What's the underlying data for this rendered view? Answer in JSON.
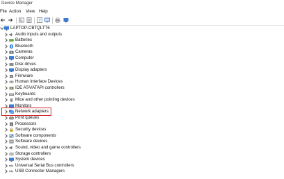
{
  "window": {
    "title": "Device Manager"
  },
  "menubar": {
    "items": [
      {
        "label": "File"
      },
      {
        "label": "Action"
      },
      {
        "label": "View"
      },
      {
        "label": "Help"
      }
    ]
  },
  "toolbar": {
    "buttons": [
      {
        "icon": "back-arrow-icon"
      },
      {
        "icon": "forward-arrow-icon"
      },
      {
        "icon": "device-view-icon"
      },
      {
        "icon": "properties-icon"
      },
      {
        "icon": "help-icon"
      },
      {
        "icon": "update-driver-icon"
      },
      {
        "icon": "print-icon"
      },
      {
        "icon": "scan-hardware-icon"
      },
      {
        "icon": "monitor-icon"
      }
    ]
  },
  "tree": {
    "root": {
      "label": "LAPTOP-CBTQLTT6",
      "icon": "computer-icon"
    },
    "categories": [
      {
        "label": "Audio inputs and outputs",
        "icon": "speaker-icon"
      },
      {
        "label": "Batteries",
        "icon": "battery-icon"
      },
      {
        "label": "Bluetooth",
        "icon": "bluetooth-icon"
      },
      {
        "label": "Cameras",
        "icon": "camera-icon"
      },
      {
        "label": "Computer",
        "icon": "computer-icon"
      },
      {
        "label": "Disk drives",
        "icon": "disk-icon"
      },
      {
        "label": "Display adapters",
        "icon": "display-adapter-icon"
      },
      {
        "label": "Firmware",
        "icon": "firmware-icon"
      },
      {
        "label": "Human Interface Devices",
        "icon": "hid-icon"
      },
      {
        "label": "IDE ATA/ATAPI controllers",
        "icon": "ide-controller-icon"
      },
      {
        "label": "Keyboards",
        "icon": "keyboard-icon"
      },
      {
        "label": "Mice and other pointing devices",
        "icon": "mouse-icon"
      },
      {
        "label": "Monitors",
        "icon": "monitor-icon"
      },
      {
        "label": "Network adapters",
        "icon": "network-adapter-icon"
      },
      {
        "label": "Print queues",
        "icon": "printer-icon"
      },
      {
        "label": "Processors",
        "icon": "processor-icon"
      },
      {
        "label": "Security devices",
        "icon": "security-icon"
      },
      {
        "label": "Software components",
        "icon": "software-component-icon"
      },
      {
        "label": "Software devices",
        "icon": "software-device-icon"
      },
      {
        "label": "Sound, video and game controllers",
        "icon": "sound-icon"
      },
      {
        "label": "Storage controllers",
        "icon": "storage-icon"
      },
      {
        "label": "System devices",
        "icon": "system-devices-icon"
      },
      {
        "label": "Universal Serial Bus controllers",
        "icon": "usb-icon"
      },
      {
        "label": "USB Connector Managers",
        "icon": "usb-icon"
      }
    ],
    "highlighted": "Network adapters"
  },
  "colors": {
    "highlight_border": "#d2232a",
    "folder_icon": "#3a7bd5",
    "background": "#ffffff"
  }
}
